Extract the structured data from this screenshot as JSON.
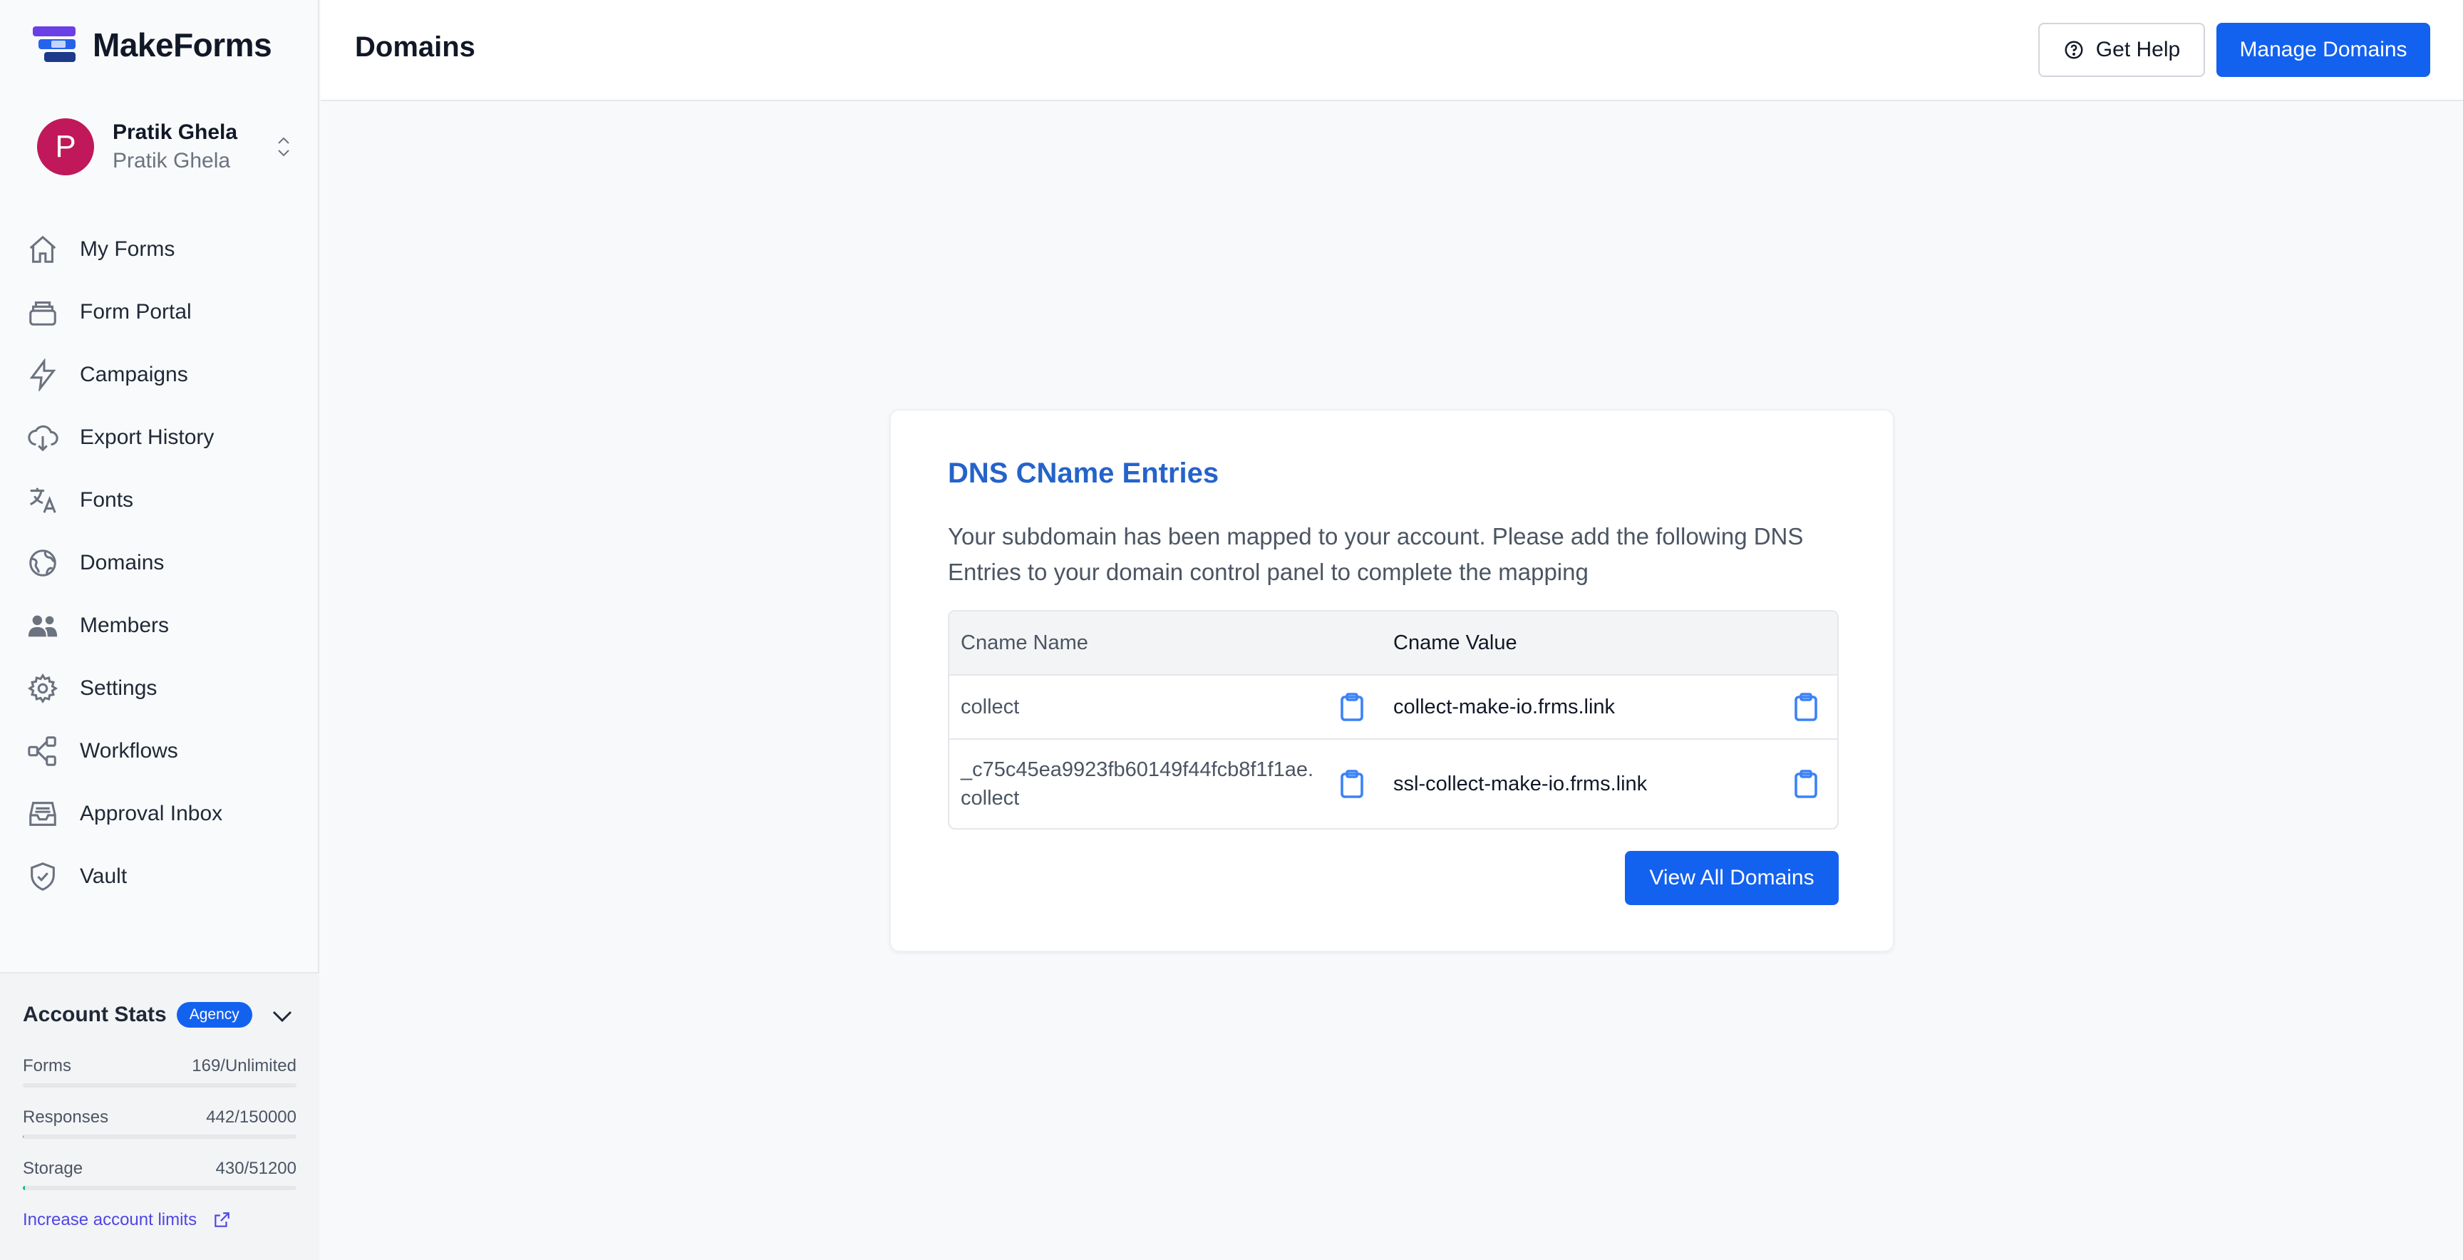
{
  "app": {
    "name": "MakeForms"
  },
  "account": {
    "initial": "P",
    "name": "Pratik Ghela",
    "workspace": "Pratik Ghela",
    "avatar_color": "#c0185a"
  },
  "nav": {
    "items": [
      {
        "label": "My Forms",
        "icon": "home-icon"
      },
      {
        "label": "Form Portal",
        "icon": "layers-icon"
      },
      {
        "label": "Campaigns",
        "icon": "lightning-icon"
      },
      {
        "label": "Export History",
        "icon": "cloud-download-icon"
      },
      {
        "label": "Fonts",
        "icon": "translate-icon"
      },
      {
        "label": "Domains",
        "icon": "globe-icon"
      },
      {
        "label": "Members",
        "icon": "users-icon"
      },
      {
        "label": "Settings",
        "icon": "gear-icon"
      },
      {
        "label": "Workflows",
        "icon": "workflow-icon"
      },
      {
        "label": "Approval Inbox",
        "icon": "inbox-icon"
      },
      {
        "label": "Vault",
        "icon": "shield-icon"
      }
    ]
  },
  "stats": {
    "title": "Account Stats",
    "plan_badge": "Agency",
    "rows": [
      {
        "label": "Forms",
        "value": "169/Unlimited",
        "fraction": 0
      },
      {
        "label": "Responses",
        "value": "442/150000",
        "fraction": 0.003
      },
      {
        "label": "Storage",
        "value": "430/51200",
        "fraction": 0.008
      }
    ],
    "link": "Increase account limits"
  },
  "header": {
    "title": "Domains",
    "help_label": "Get Help",
    "manage_label": "Manage Domains"
  },
  "card": {
    "title": "DNS CName Entries",
    "description": "Your subdomain has been mapped to your account. Please add the following DNS Entries to your domain control panel to complete the mapping",
    "columns": [
      "Cname Name",
      "Cname Value"
    ],
    "rows": [
      {
        "name": "collect",
        "value": "collect-make-io.frms.link"
      },
      {
        "name": "_c75c45ea9923fb60149f44fcb8f1f1ae.\ncollect",
        "value": "ssl-collect-make-io.frms.link"
      }
    ],
    "view_all_label": "View All Domains"
  },
  "colors": {
    "primary": "#1361ef",
    "title_blue": "#2563c9",
    "progress": "#10b981"
  }
}
